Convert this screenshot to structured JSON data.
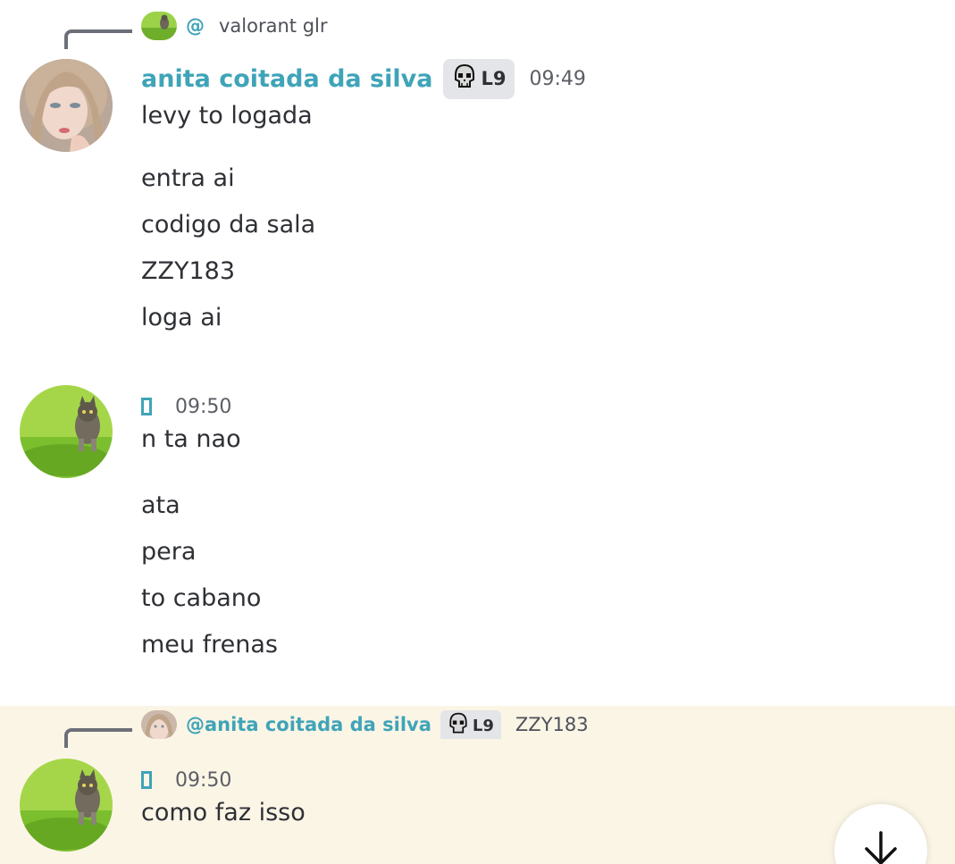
{
  "reply1": {
    "mention": "@𝅳",
    "text": "valorant glr"
  },
  "message1": {
    "username": "anita coitada da silva",
    "badge": "L9",
    "time": "09:49",
    "lines": [
      "levy to logada",
      "entra ai",
      "codigo da sala",
      "ZZY183",
      "loga ai"
    ]
  },
  "message2": {
    "time": "09:50",
    "lines": [
      "n ta nao",
      "ata",
      "pera",
      "to cabano",
      "meu frenas"
    ]
  },
  "reply2": {
    "mention": "@anita coitada da silva",
    "badge": "L9",
    "text": "ZZY183"
  },
  "message3": {
    "time": "09:50",
    "lines": [
      "como faz isso"
    ]
  },
  "icons": {
    "badge_icon": "skull-icon",
    "scroll_icon": "arrow-down-icon"
  },
  "colors": {
    "username": "#3fa4b8",
    "highlight_bg": "#fbf5e6"
  }
}
